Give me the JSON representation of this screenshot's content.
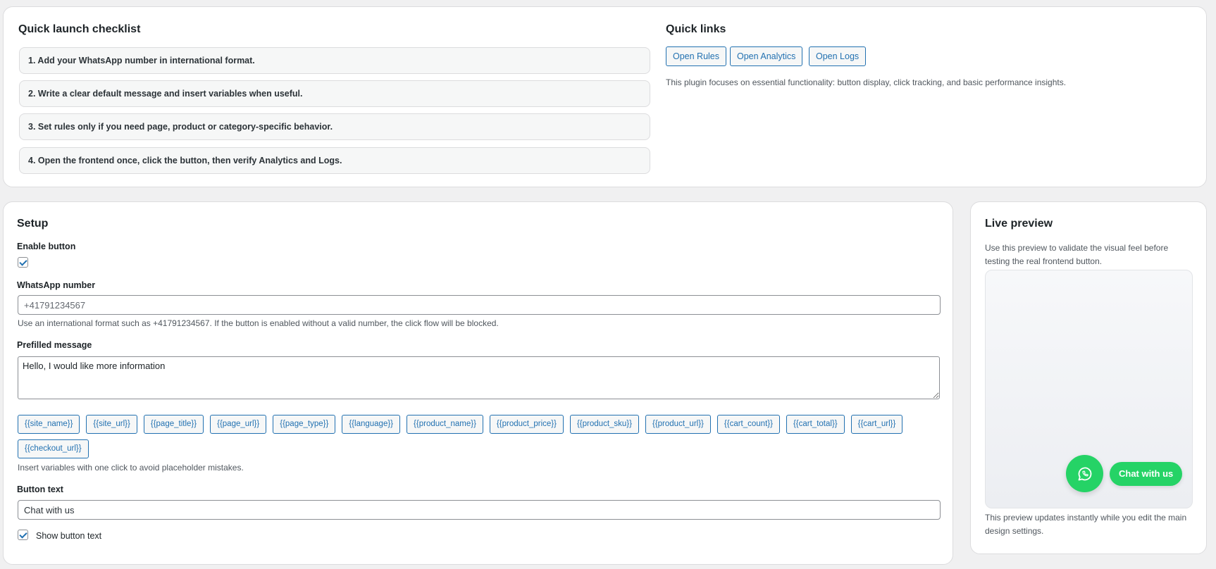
{
  "checklist": {
    "title": "Quick launch checklist",
    "items": [
      "1. Add your WhatsApp number in international format.",
      "2. Write a clear default message and insert variables when useful.",
      "3. Set rules only if you need page, product or category-specific behavior.",
      "4. Open the frontend once, click the button, then verify Analytics and Logs."
    ]
  },
  "quick_links": {
    "title": "Quick links",
    "buttons": [
      "Open Rules",
      "Open Analytics",
      "Open Logs"
    ],
    "description": "This plugin focuses on essential functionality: button display, click tracking, and basic performance insights."
  },
  "setup": {
    "title": "Setup",
    "enable_label": "Enable button",
    "enable_checked": true,
    "number_label": "WhatsApp number",
    "number_placeholder": "+41791234567",
    "number_help": "Use an international format such as +41791234567. If the button is enabled without a valid number, the click flow will be blocked.",
    "message_label": "Prefilled message",
    "message_value": "Hello, I would like more information",
    "variables": [
      "{{site_name}}",
      "{{site_url}}",
      "{{page_title}}",
      "{{page_url}}",
      "{{page_type}}",
      "{{language}}",
      "{{product_name}}",
      "{{product_price}}",
      "{{product_sku}}",
      "{{product_url}}",
      "{{cart_count}}",
      "{{cart_total}}",
      "{{cart_url}}",
      "{{checkout_url}}"
    ],
    "variables_help": "Insert variables with one click to avoid placeholder mistakes.",
    "button_text_label": "Button text",
    "button_text_value": "Chat with us",
    "show_text_label": "Show button text",
    "show_text_checked": true
  },
  "preview": {
    "title": "Live preview",
    "intro": "Use this preview to validate the visual feel before testing the real frontend button.",
    "button_label": "Chat with us",
    "icon": "whatsapp-icon",
    "accent_color": "#25d366",
    "footer": "This preview updates instantly while you edit the main design settings."
  }
}
